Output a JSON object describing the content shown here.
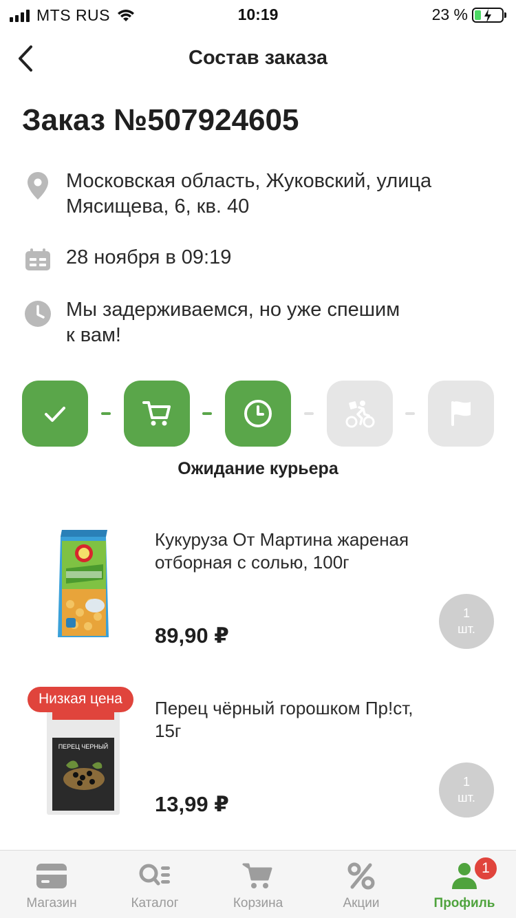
{
  "status_bar": {
    "carrier": "MTS RUS",
    "time": "10:19",
    "battery": "23 %"
  },
  "header": {
    "title": "Состав заказа"
  },
  "order": {
    "title": "Заказ №507924605",
    "address_line1": "Московская область, Жуковский, улица",
    "address_line2": "Мясищева, 6, кв. 40",
    "datetime": "28 ноября в 09:19",
    "delay_line1": "Мы задерживаемся, но уже спешим",
    "delay_line2": "к вам!"
  },
  "progress": {
    "completed_steps": 3,
    "total_steps": 5,
    "status_caption": "Ожидание курьера",
    "accent_color": "#5aa64a",
    "inactive_color": "#e6e6e6"
  },
  "products": [
    {
      "name_line1": "Кукуруза От Мартина жареная",
      "name_line2": "отборная с солью, 100г",
      "price": "89,90 ₽",
      "qty_value": "1",
      "qty_unit": "шт."
    },
    {
      "badge": "Низкая цена",
      "name_line1": "Перец чёрный горошком Пр!ст, 15г",
      "price": "13,99 ₽",
      "qty_value": "1",
      "qty_unit": "шт.",
      "package_label": "ПЕРЕЦ ЧЕРНЫЙ"
    }
  ],
  "tabs": [
    {
      "label": "Магазин",
      "icon": "wallet-icon"
    },
    {
      "label": "Каталог",
      "icon": "catalog-search-icon"
    },
    {
      "label": "Корзина",
      "icon": "cart-icon"
    },
    {
      "label": "Акции",
      "icon": "percent-icon"
    },
    {
      "label": "Профиль",
      "icon": "profile-icon",
      "badge": "1",
      "active": true
    }
  ]
}
